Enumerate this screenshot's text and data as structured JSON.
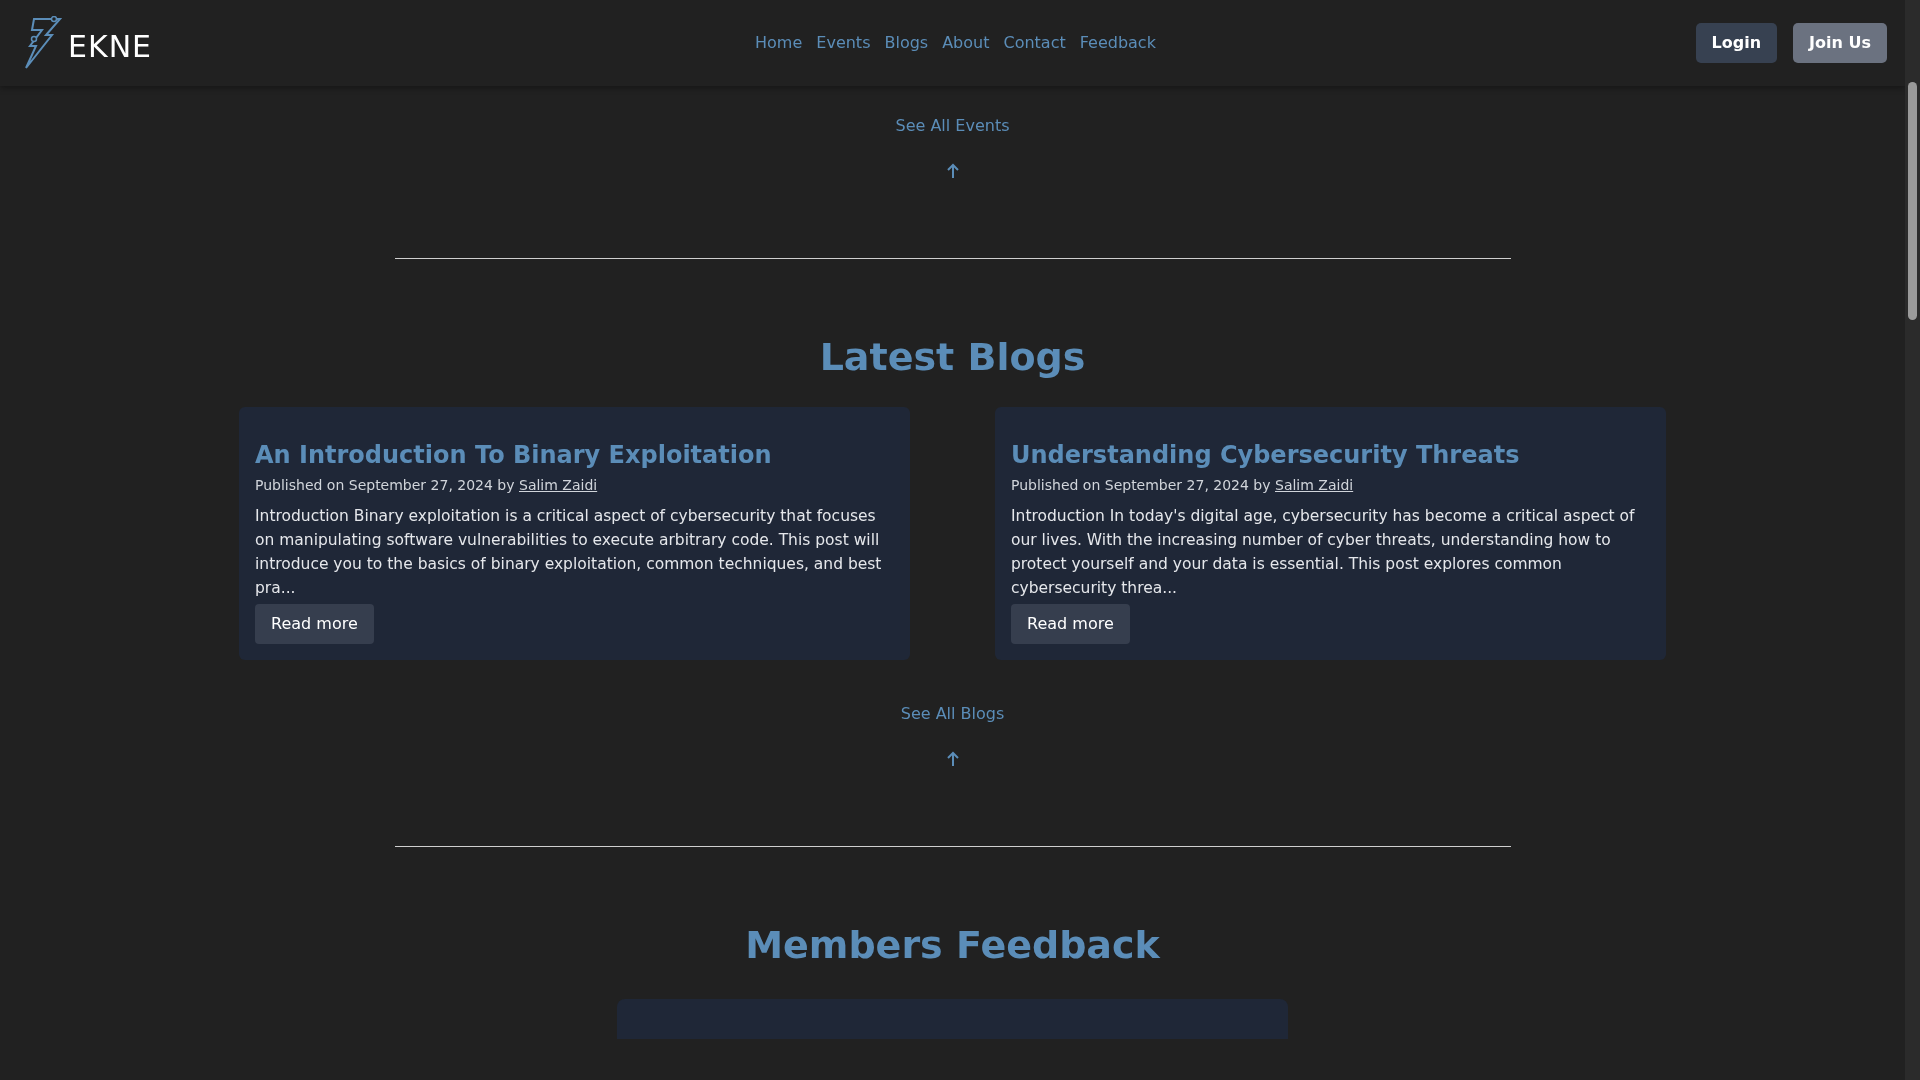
{
  "brand": {
    "name": "EKNE"
  },
  "nav": [
    {
      "label": "Home"
    },
    {
      "label": "Events"
    },
    {
      "label": "Blogs"
    },
    {
      "label": "About"
    },
    {
      "label": "Contact"
    },
    {
      "label": "Feedback"
    }
  ],
  "auth_buttons": [
    {
      "label": "Login",
      "kind": "dark"
    },
    {
      "label": "Join Us",
      "kind": "light"
    }
  ],
  "events_footer": {
    "link": "See All Events"
  },
  "blogs": {
    "heading": "Latest Blogs",
    "posts": [
      {
        "title": "An Introduction To Binary Exploitation",
        "meta": "Published on September 27, 2024 by",
        "author": "Salim Zaidi",
        "excerpt": "Introduction Binary exploitation is a critical aspect of cybersecurity that focuses on manipulating software vulnerabilities to execute arbitrary code. This post will introduce you to the basics of binary exploitation, common techniques, and best pra...",
        "button": "Read more"
      },
      {
        "title": "Understanding Cybersecurity Threats",
        "meta": "Published on September 27, 2024 by",
        "author": "Salim Zaidi",
        "excerpt": "Introduction In today's digital age, cybersecurity has become a critical aspect of our lives. With the increasing number of cyber threats, understanding how to protect yourself and your data is essential. This post explores common cybersecurity threa...",
        "button": "Read more"
      }
    ],
    "link": "See All Blogs"
  },
  "feedback": {
    "heading": "Members Feedback"
  }
}
